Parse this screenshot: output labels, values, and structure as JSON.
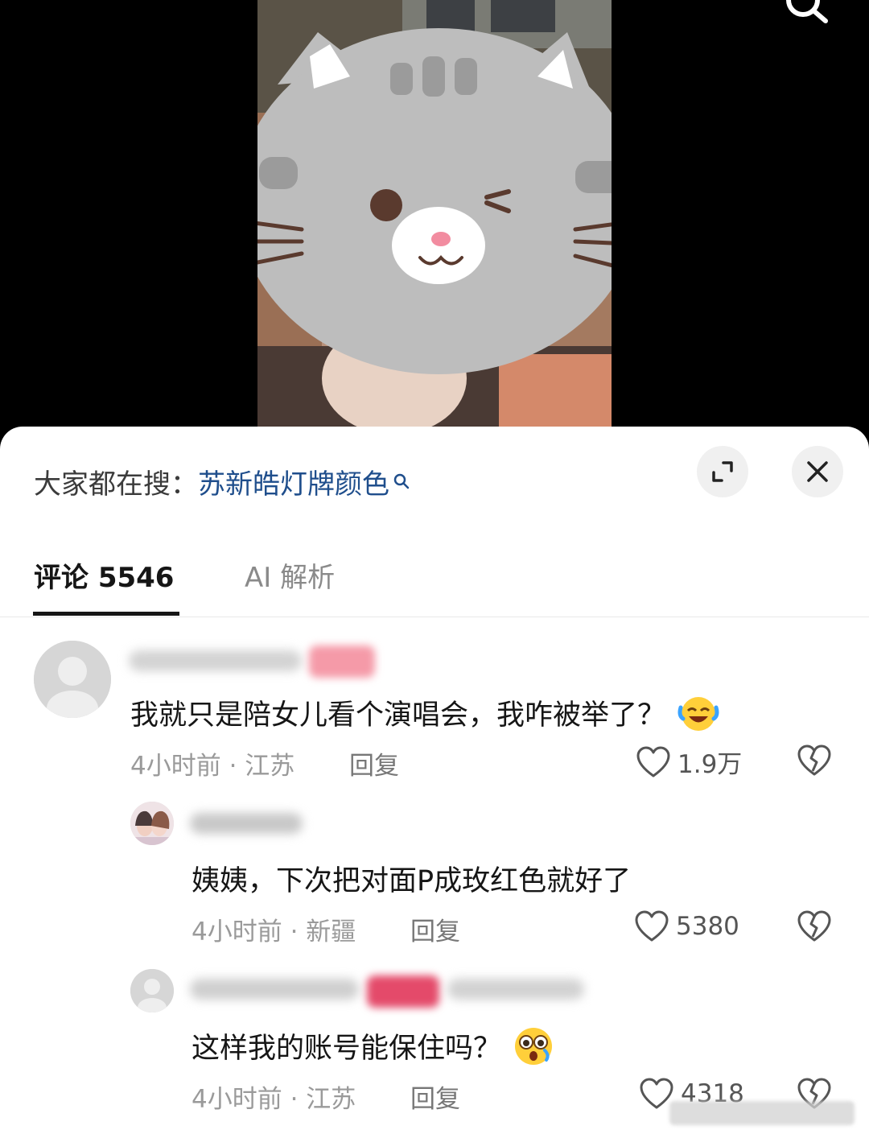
{
  "trending": {
    "prefix": "大家都在搜：",
    "keyword": "苏新皓灯牌颜色"
  },
  "tabs": [
    {
      "label": "评论 5546",
      "active": true
    },
    {
      "label": "AI 解析",
      "active": false
    }
  ],
  "comments": [
    {
      "text": "我就只是陪女儿看个演唱会，我咋被举了？",
      "emoji": "rolling-laughing-emoji",
      "meta": "4小时前 · 江苏",
      "reply": "回复",
      "likes": "1.9万"
    },
    {
      "text": "姨姨，下次把对面P成玫红色就好了",
      "meta": "4小时前 · 新疆",
      "reply": "回复",
      "likes": "5380"
    },
    {
      "text": "这样我的账号能保住吗？",
      "emoji": "flushed-emoji",
      "meta": "4小时前 · 江苏",
      "reply": "回复",
      "likes": "4318"
    }
  ],
  "colors": {
    "keyword": "#1f4e8c",
    "text": "#161616",
    "meta": "#9a9a9a",
    "badge": "#f59aa8"
  }
}
